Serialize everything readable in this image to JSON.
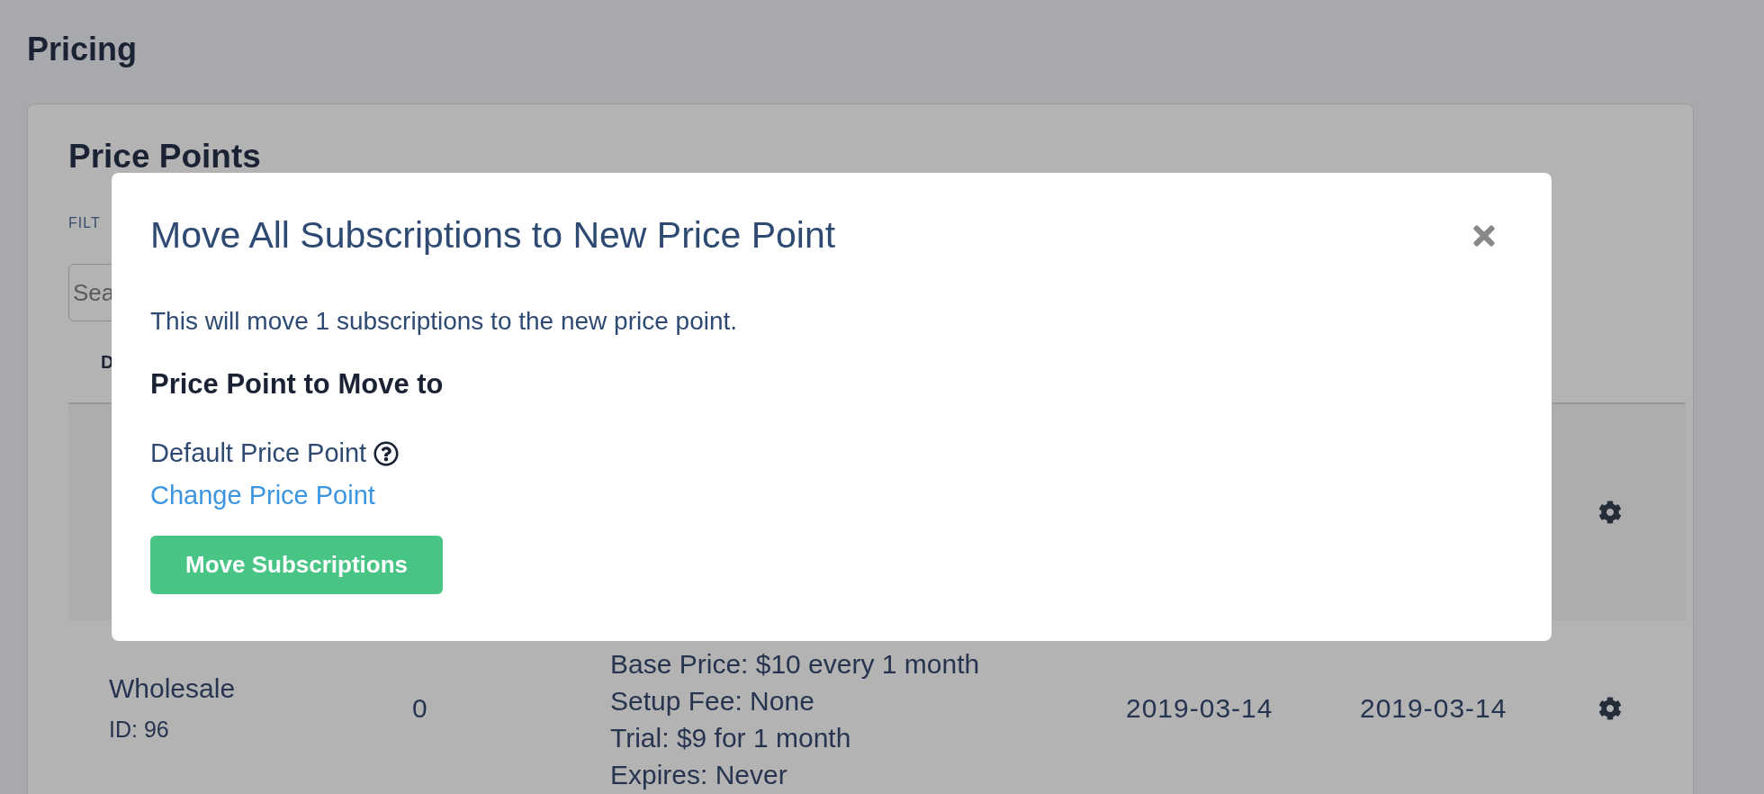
{
  "page_title": "Pricing",
  "card": {
    "title": "Price Points",
    "filter_label": "FILT",
    "search": {
      "placeholder": "Sea"
    },
    "table": {
      "columns": [
        {
          "label": "D"
        }
      ],
      "rows": [
        {
          "highlighted": true
        },
        {
          "highlighted": false,
          "name": "Wholesale",
          "id": "ID: 96",
          "subscriptions": "0",
          "pricing": [
            "Base Price: $10 every 1 month",
            "Setup Fee: None",
            "Trial: $9 for 1 month",
            "Expires: Never"
          ],
          "created": "2019-03-14",
          "updated": "2019-03-14"
        }
      ]
    }
  },
  "modal": {
    "title": "Move All Subscriptions to New Price Point",
    "message": "This will move 1 subscriptions to the new price point.",
    "section_heading": "Price Point to Move to",
    "current_price_point": "Default Price Point",
    "change_link": "Change Price Point",
    "button": "Move Subscriptions"
  }
}
